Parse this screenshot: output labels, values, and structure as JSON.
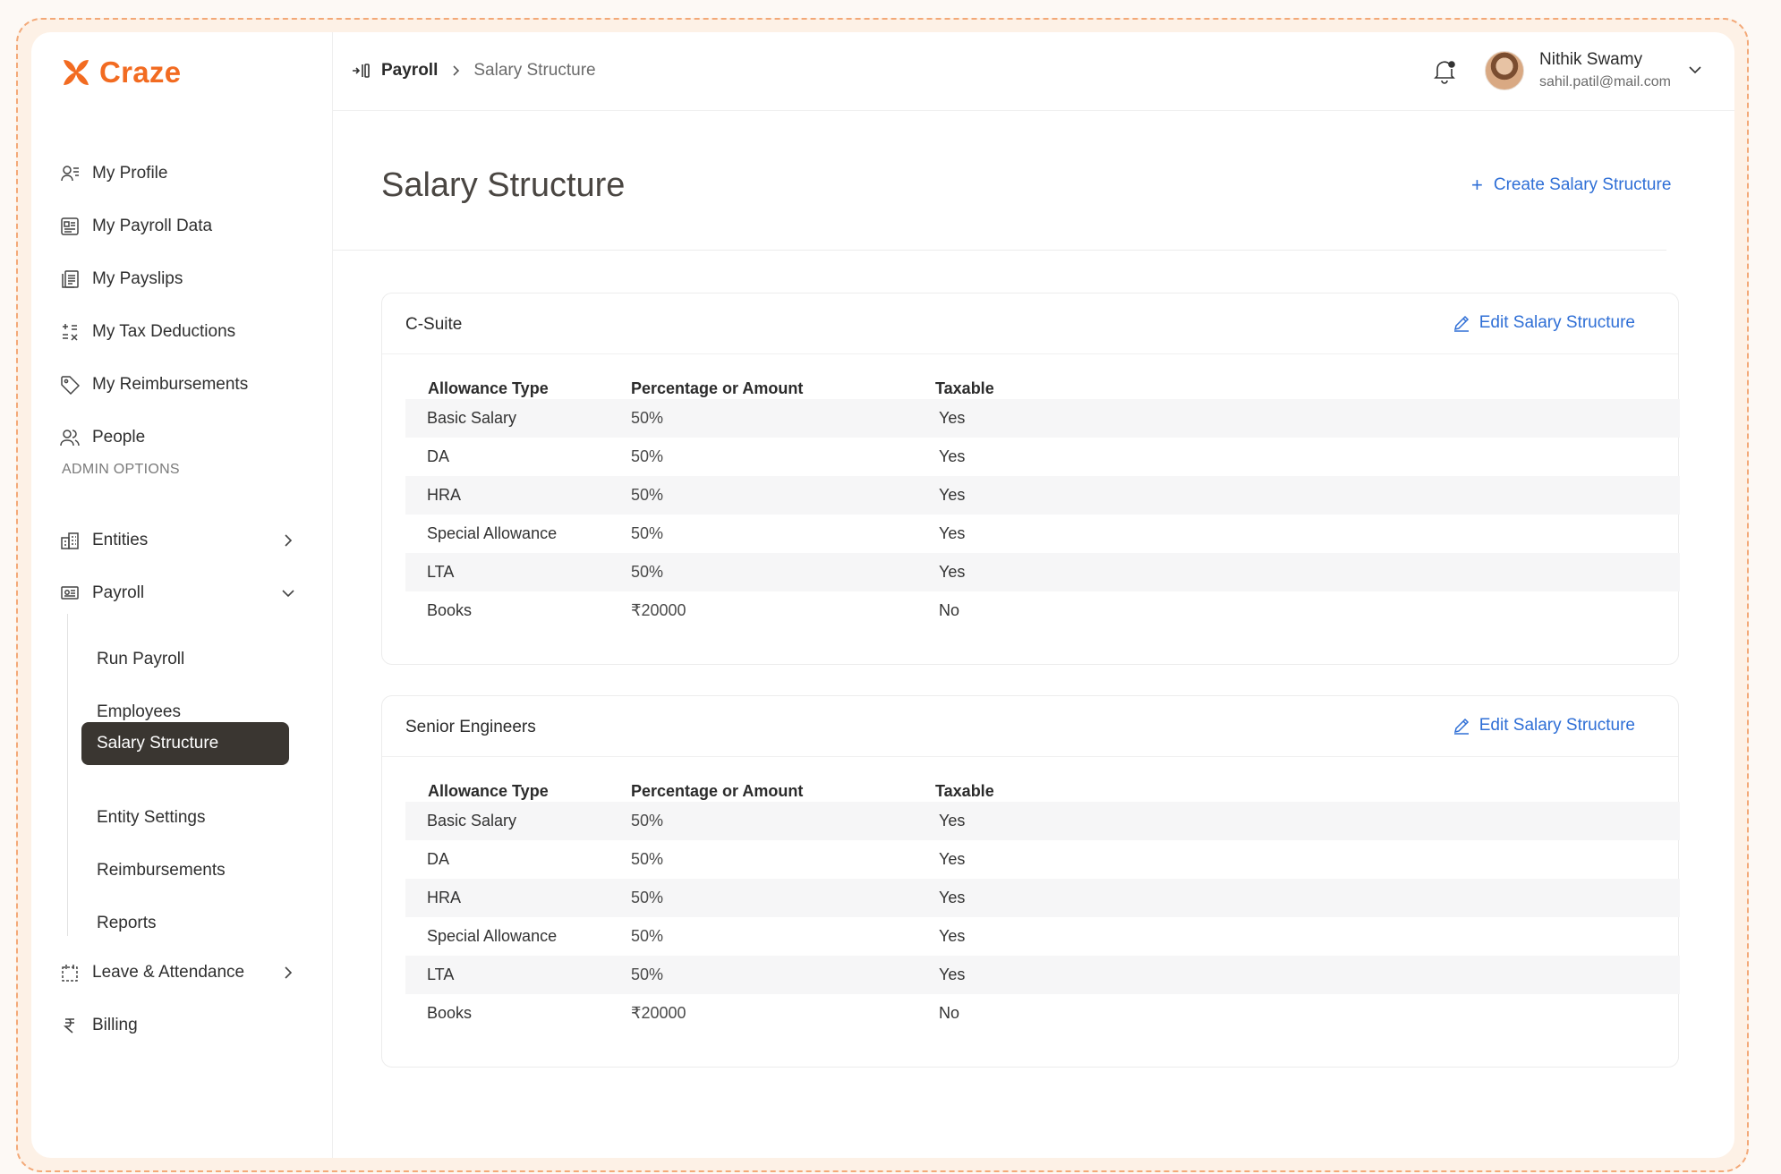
{
  "brand": {
    "name": "Craze",
    "accent": "#f26b21",
    "link_color": "#2f6fd6",
    "active_bg": "#3a3631"
  },
  "sidebar": {
    "items": [
      {
        "label": "My Profile",
        "icon": "user-lines-icon"
      },
      {
        "label": "My Payroll Data",
        "icon": "id-card-icon"
      },
      {
        "label": "My Payslips",
        "icon": "documents-icon"
      },
      {
        "label": "My Tax Deductions",
        "icon": "tax-icon"
      },
      {
        "label": "My Reimbursements",
        "icon": "tag-icon"
      },
      {
        "label": "People",
        "icon": "people-icon"
      }
    ],
    "admin_label": "ADMIN OPTIONS",
    "admin_items": [
      {
        "label": "Entities",
        "icon": "building-icon",
        "chevron": "chevron-right-icon"
      },
      {
        "label": "Payroll",
        "icon": "payroll-icon",
        "chevron": "chevron-down-icon"
      }
    ],
    "payroll_sub": [
      {
        "label": "Run Payroll"
      },
      {
        "label": "Employees"
      },
      {
        "label": "Salary Structure",
        "active": true
      },
      {
        "label": "Entity Settings"
      },
      {
        "label": "Reimbursements"
      },
      {
        "label": "Reports"
      }
    ],
    "bottom_items": [
      {
        "label": "Leave & Attendance",
        "icon": "calendar-icon",
        "chevron": "chevron-right-icon"
      },
      {
        "label": "Billing",
        "icon": "rupee-icon"
      }
    ]
  },
  "header": {
    "breadcrumb": {
      "parent": "Payroll",
      "current": "Salary Structure"
    },
    "user": {
      "name": "Nithik Swamy",
      "email": "sahil.patil@mail.com"
    }
  },
  "page": {
    "title": "Salary Structure",
    "create_label": "Create Salary Structure"
  },
  "structures": [
    {
      "name": "C-Suite",
      "edit_label": "Edit Salary Structure",
      "columns": [
        "Allowance Type",
        "Percentage or Amount",
        "Taxable"
      ],
      "rows": [
        [
          "Basic Salary",
          "50%",
          "Yes"
        ],
        [
          "DA",
          "50%",
          "Yes"
        ],
        [
          "HRA",
          "50%",
          "Yes"
        ],
        [
          "Special Allowance",
          "50%",
          "Yes"
        ],
        [
          "LTA",
          "50%",
          "Yes"
        ],
        [
          "Books",
          "₹20000",
          "No"
        ]
      ]
    },
    {
      "name": "Senior Engineers",
      "edit_label": "Edit Salary Structure",
      "columns": [
        "Allowance Type",
        "Percentage or Amount",
        "Taxable"
      ],
      "rows": [
        [
          "Basic Salary",
          "50%",
          "Yes"
        ],
        [
          "DA",
          "50%",
          "Yes"
        ],
        [
          "HRA",
          "50%",
          "Yes"
        ],
        [
          "Special Allowance",
          "50%",
          "Yes"
        ],
        [
          "LTA",
          "50%",
          "Yes"
        ],
        [
          "Books",
          "₹20000",
          "No"
        ]
      ]
    }
  ]
}
